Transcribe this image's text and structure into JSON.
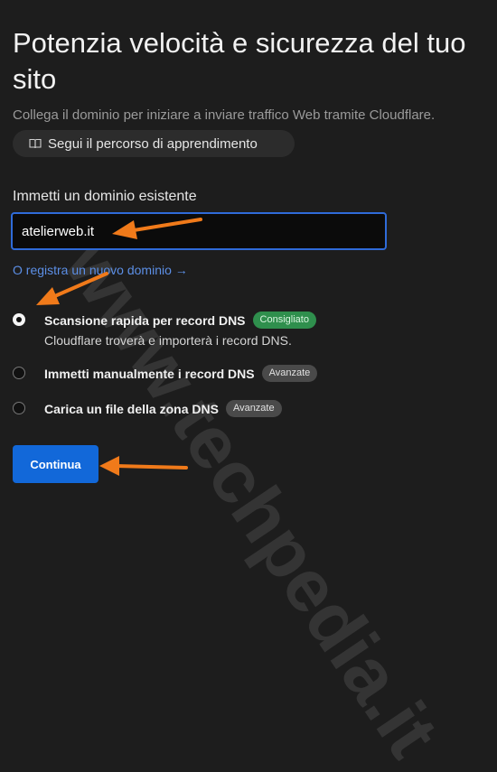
{
  "header": {
    "title": "Potenzia velocità e sicurezza del tuo sito",
    "subtitle": "Collega il dominio per iniziare a inviare traffico Web tramite Cloudflare."
  },
  "learn_button": {
    "label": "Segui il percorso di apprendimento",
    "icon": "book-icon"
  },
  "domain_field": {
    "label": "Immetti un dominio esistente",
    "value": "atelierweb.it"
  },
  "register_link": "O registra un nuovo dominio →",
  "options": [
    {
      "title": "Scansione rapida per record DNS",
      "badge": "Consigliato",
      "description": "Cloudflare troverà e importerà i record DNS.",
      "selected": true
    },
    {
      "title": "Immetti manualmente i record DNS",
      "badge": "Avanzate",
      "selected": false
    },
    {
      "title": "Carica un file della zona DNS",
      "badge": "Avanzate",
      "selected": false
    }
  ],
  "continue_button": {
    "label": "Continua"
  },
  "watermark": "www.techpedia.it",
  "colors": {
    "background": "#1d1d1d",
    "accent_blue": "#1268d9",
    "link_blue": "#5c8fe6",
    "annotation_orange": "#f07a1a",
    "badge_green": "#2f8f4d"
  }
}
